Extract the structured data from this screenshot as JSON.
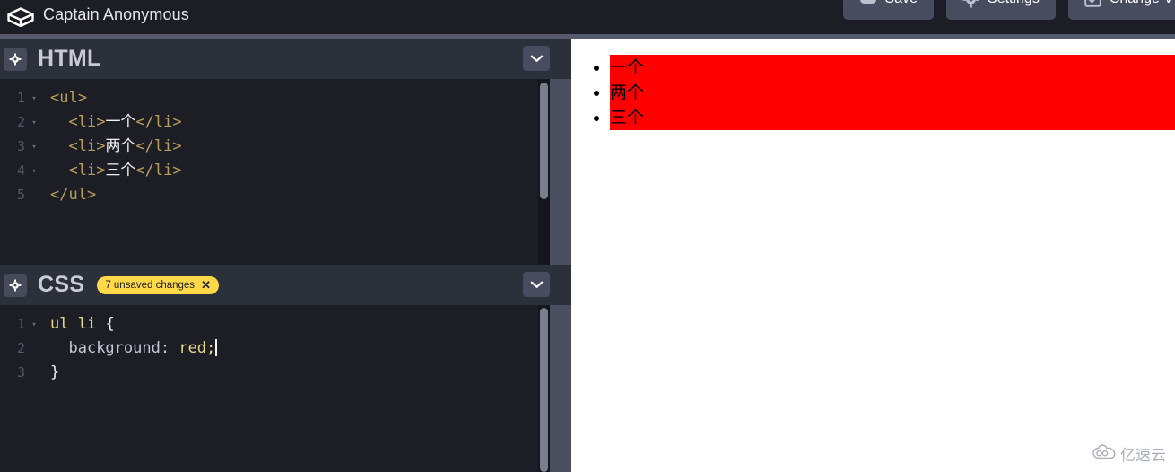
{
  "topnav": {
    "logo_icon": "codepen-logo-icon",
    "username": "Captain Anonymous",
    "buttons": [
      {
        "label": "Save",
        "icon": "save-cloud-icon"
      },
      {
        "label": "Settings",
        "icon": "gear-icon"
      },
      {
        "label": "Change V",
        "icon": "change-view-icon"
      }
    ]
  },
  "html_panel": {
    "title": "HTML",
    "settings_icon": "gear-icon",
    "collapse_icon": "chevron-down-icon",
    "lines": [
      {
        "num": "1",
        "fold": "▾"
      },
      {
        "num": "2",
        "fold": "▾"
      },
      {
        "num": "3",
        "fold": "▾"
      },
      {
        "num": "4",
        "fold": "▾"
      },
      {
        "num": "5",
        "fold": ""
      }
    ],
    "code": {
      "l1_open": "<ul>",
      "l2_open": "<li>",
      "l2_text": "一个",
      "l2_close": "</li>",
      "l3_open": "<li>",
      "l3_text": "两个",
      "l3_close": "</li>",
      "l4_open": "<li>",
      "l4_text": "三个",
      "l4_close": "</li>",
      "l5_close": "</ul>"
    }
  },
  "css_panel": {
    "title": "CSS",
    "settings_icon": "gear-icon",
    "collapse_icon": "chevron-down-icon",
    "badge_label": "7 unsaved changes",
    "badge_close": "✕",
    "lines": [
      {
        "num": "1",
        "fold": "▾"
      },
      {
        "num": "2",
        "fold": ""
      },
      {
        "num": "3",
        "fold": ""
      }
    ],
    "code": {
      "l1_selector": "ul li",
      "l1_brace": "{",
      "l2_prop": "background:",
      "l2_val": "red;",
      "l3_brace": "}"
    }
  },
  "preview": {
    "items": [
      "一个",
      "两个",
      "三个"
    ],
    "item_background": "#ff0000"
  },
  "watermark": {
    "text": "亿速云",
    "icon": "cloud-icon"
  }
}
